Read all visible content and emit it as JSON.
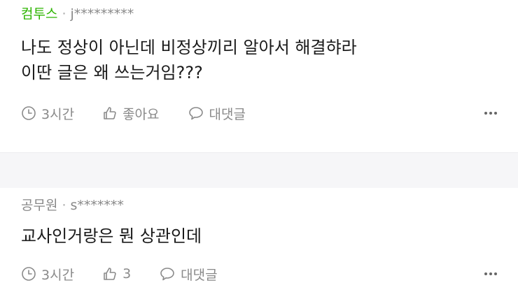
{
  "comments": [
    {
      "author": "컴투스",
      "separator": "·",
      "user_id": "j*********",
      "body": "나도 정상이 아닌데 비정상끼리 알아서 해결햐라\n이딴 글은 왜 쓰는거임???",
      "time": "3시간",
      "like_label": "좋아요",
      "reply_label": "대댓글",
      "author_color": "#2db400"
    },
    {
      "author": "공무원",
      "separator": "·",
      "user_id": "s*******",
      "body": "교사인거랑은 뭔 상관인데",
      "time": "3시간",
      "like_label": "3",
      "reply_label": "대댓글",
      "author_color": "#888888"
    }
  ],
  "icons": {
    "time": "clock-icon",
    "like": "thumbs-up-icon",
    "reply": "speech-bubble-icon",
    "more": "more-dots-icon"
  }
}
